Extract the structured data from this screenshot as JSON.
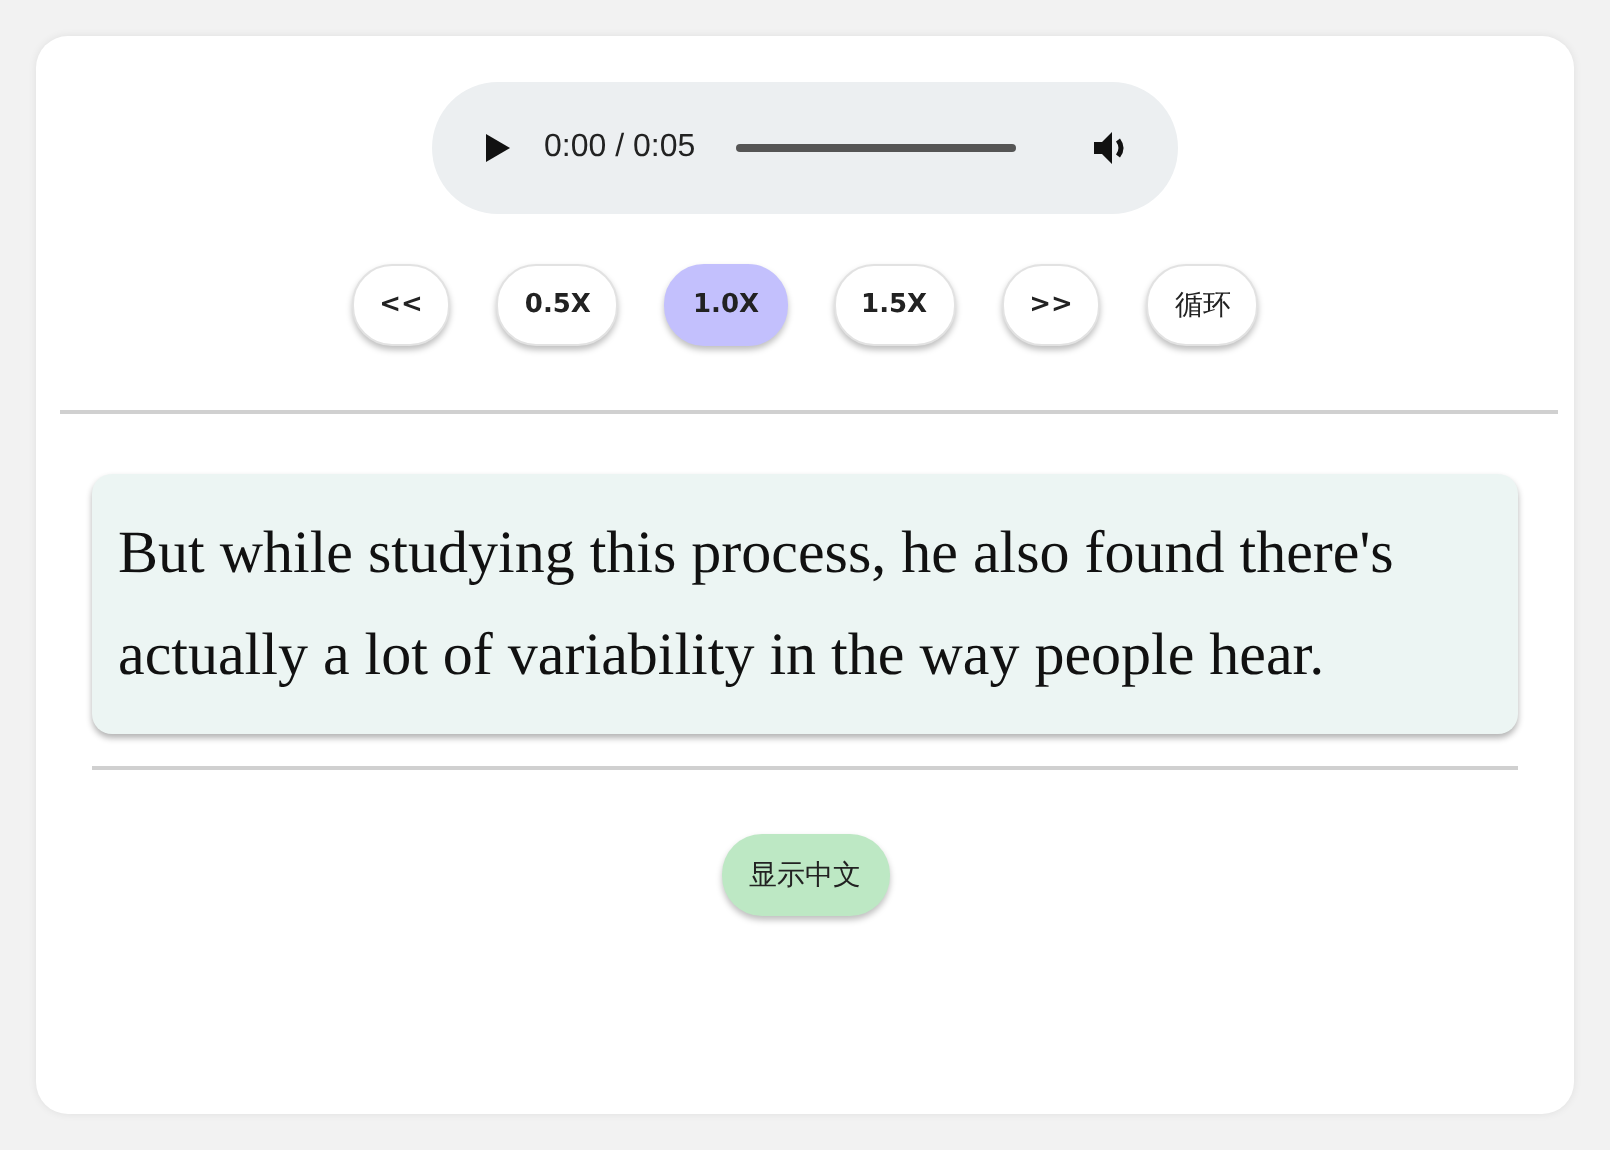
{
  "player": {
    "time": "0:00 / 0:05"
  },
  "controls": [
    {
      "label": "<<",
      "selected": false
    },
    {
      "label": "0.5X",
      "selected": false
    },
    {
      "label": "1.0X",
      "selected": true
    },
    {
      "label": "1.5X",
      "selected": false
    },
    {
      "label": ">>",
      "selected": false
    },
    {
      "label": "循环",
      "selected": false
    }
  ],
  "sentence": "But while studying this process, he also found there's actually a lot of variability in the way people hear.",
  "translate_button": "显示中文"
}
